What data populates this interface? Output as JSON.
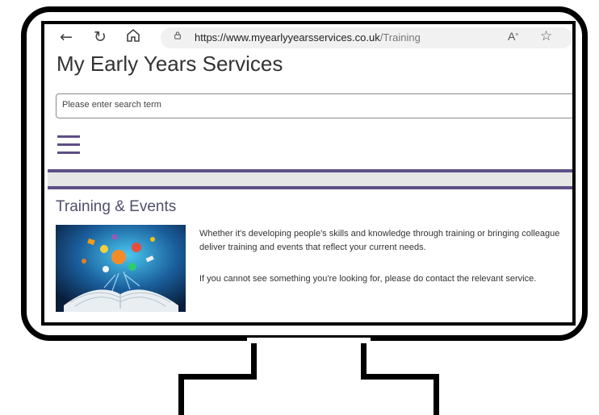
{
  "browser": {
    "url_host": "https://www.myearlyyearsservices.co.uk",
    "url_path": "/Training"
  },
  "site": {
    "title": "My Early Years Services"
  },
  "search": {
    "placeholder": "Please enter search term"
  },
  "section": {
    "title": "Training & Events",
    "paragraph_1_line_1": "Whether it's developing people's skills and knowledge through training or bringing colleague",
    "paragraph_1_line_2": "deliver training and events that reflect your current needs.",
    "paragraph_2": "If you cannot see something you're looking for, please do contact the relevant service."
  },
  "colors": {
    "accent": "#5d4f86",
    "band": "#e6e6e6",
    "frame": "#000000"
  },
  "icons": {
    "back": "back-arrow-icon",
    "refresh": "refresh-icon",
    "home": "home-icon",
    "lock": "lock-icon",
    "read_aloud": "read-aloud-icon",
    "favorite": "star-icon",
    "menu": "hamburger-menu-icon"
  }
}
